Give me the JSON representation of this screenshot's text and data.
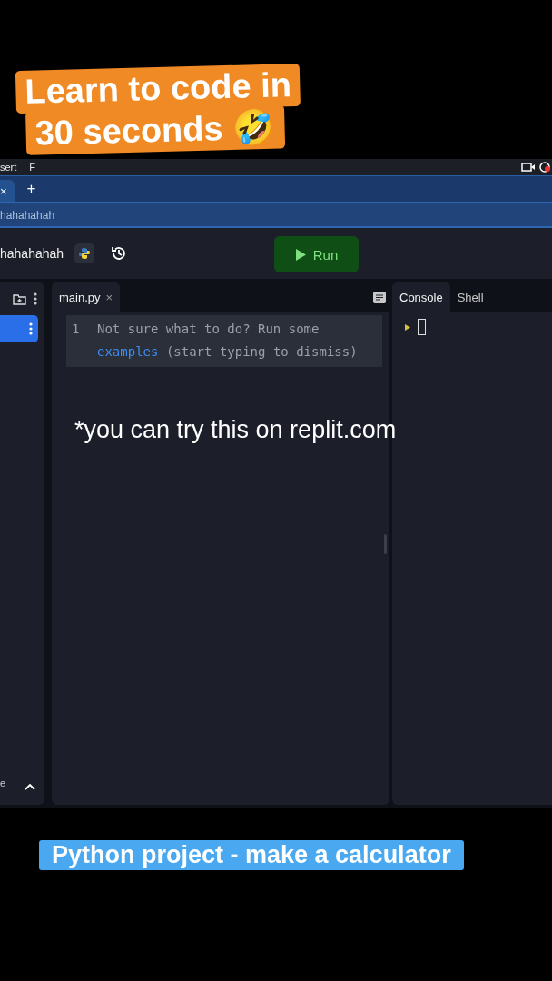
{
  "sticker": {
    "lines": [
      "Learn to code in",
      "30 seconds 🤣"
    ]
  },
  "menu_bar": {
    "items": [
      "sert",
      "F"
    ]
  },
  "browser": {
    "tabs": [
      {
        "close": "×",
        "selected": true
      }
    ],
    "new_tab": "+",
    "address": "hahahahah"
  },
  "header": {
    "project_name": "hahahahah",
    "run_button": "Run"
  },
  "sidebar": {
    "items": [
      {
        "selected": true
      }
    ],
    "footer_label": "e"
  },
  "editor": {
    "tabs": [
      {
        "label": "main.py",
        "close": "×",
        "selected": true
      }
    ],
    "line_number": "1",
    "hint_before": "Not sure what to do? Run some",
    "hint_link": "examples",
    "hint_after": "(start typing to dismiss)"
  },
  "console": {
    "tabs": [
      {
        "label": "Console",
        "selected": true
      },
      {
        "label": "Shell",
        "selected": false
      }
    ]
  },
  "overlay_caption": "*you can try this on replit.com",
  "bottom_caption": "Python project - make a calculator"
}
